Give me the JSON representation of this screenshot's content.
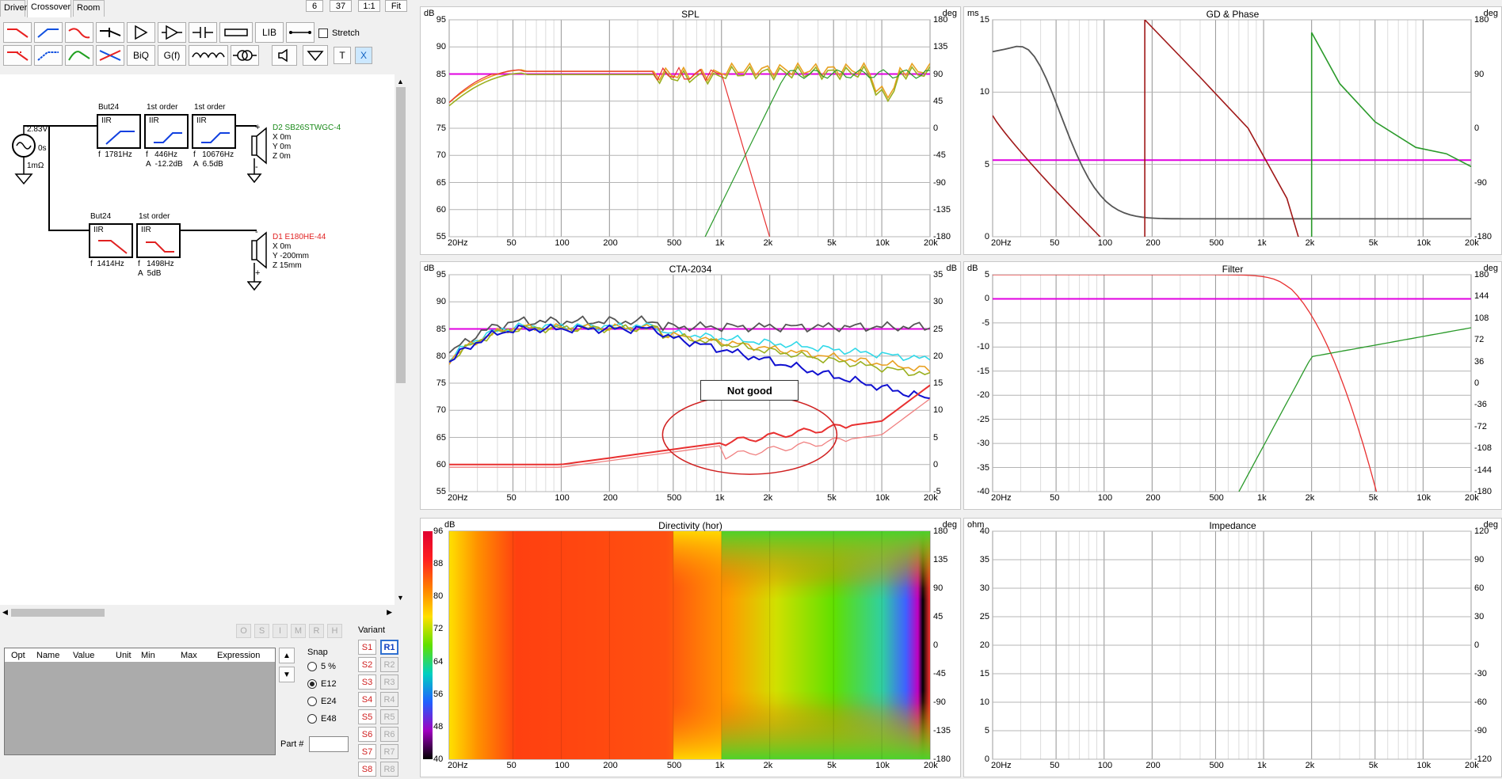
{
  "tabs": [
    "Drivers",
    "Crossover",
    "Room"
  ],
  "top_buttons": [
    "6",
    "37",
    "1:1",
    "Fit"
  ],
  "toolbar": {
    "lib": "LIB",
    "biq": "BiQ",
    "gf": "G(f)",
    "t": "T",
    "x": "X",
    "stretch": "Stretch"
  },
  "schematic": {
    "source": {
      "voltage": "2.83V",
      "delay": "0s",
      "resistance": "1mΩ"
    },
    "tweeter_chain": [
      {
        "title": "But24",
        "type": "IIR",
        "params": "f  1781Hz"
      },
      {
        "title": "1st order",
        "type": "IIR",
        "params": "f   446Hz\nA  -12.2dB"
      },
      {
        "title": "1st order",
        "type": "IIR",
        "params": "f   10676Hz\nA  6.5dB"
      }
    ],
    "woofer_chain": [
      {
        "title": "But24",
        "type": "IIR",
        "params": "f  1414Hz"
      },
      {
        "title": "1st order",
        "type": "IIR",
        "params": "f   1498Hz\nA  5dB"
      }
    ],
    "tweeter": {
      "name": "D2 SB26STWGC-4",
      "lines": [
        "X 0m",
        "Y 0m",
        "Z 0m"
      ]
    },
    "woofer": {
      "name": "D1 E180HE-44",
      "lines": [
        "X 0m",
        "Y -200mm",
        "Z 15mm"
      ]
    }
  },
  "optimizer": {
    "buttons": [
      "O",
      "S",
      "I",
      "M",
      "R",
      "H"
    ],
    "columns": [
      "Opt",
      "Name",
      "Value",
      "Unit",
      "Min",
      "Max",
      "Expression"
    ]
  },
  "snap": {
    "label": "Snap",
    "options": [
      "5 %",
      "E12",
      "E24",
      "E48"
    ],
    "selected": 1
  },
  "part_label": "Part #",
  "variant": {
    "label": "Variant",
    "s": [
      "S1",
      "S2",
      "S3",
      "S4",
      "S5",
      "S6",
      "S7",
      "S8"
    ],
    "r": [
      "R1",
      "R2",
      "R3",
      "R4",
      "R5",
      "R6",
      "R7",
      "R8"
    ]
  },
  "colors": {
    "magenta": "#e000e0",
    "red": "#e83030",
    "green": "#2a9a2a",
    "darkred": "#a01818",
    "blue": "#1010d0",
    "gray": "#555555",
    "olive": "#9ab020",
    "orange": "#e8a020",
    "cyan": "#30d8e8"
  },
  "freq_ticks": [
    "20Hz",
    "50",
    "100",
    "200",
    "500",
    "1k",
    "2k",
    "5k",
    "10k",
    "20k"
  ],
  "panels": {
    "spl": {
      "title": "SPL",
      "ylabel": "dB",
      "y2label": "deg",
      "yticks": [
        "95",
        "90",
        "85",
        "80",
        "75",
        "70",
        "65",
        "60",
        "55"
      ],
      "y2ticks": [
        "180",
        "135",
        "90",
        "45",
        "0",
        "-45",
        "-90",
        "-135",
        "-180"
      ]
    },
    "gd": {
      "title": "GD & Phase",
      "ylabel": "ms",
      "y2label": "deg",
      "yticks": [
        "15",
        "10",
        "5",
        "0"
      ],
      "y2ticks": [
        "180",
        "90",
        "0",
        "-90",
        "-180"
      ]
    },
    "cta": {
      "title": "CTA-2034",
      "ylabel": "dB",
      "y2label": "dB",
      "yticks": [
        "95",
        "90",
        "85",
        "80",
        "75",
        "70",
        "65",
        "60",
        "55"
      ],
      "y2ticks": [
        "35",
        "30",
        "25",
        "20",
        "15",
        "10",
        "5",
        "0",
        "-5"
      ],
      "annotation": "Not good"
    },
    "filter": {
      "title": "Filter",
      "ylabel": "dB",
      "y2label": "deg",
      "yticks": [
        "5",
        "0",
        "-5",
        "-10",
        "-15",
        "-20",
        "-25",
        "-30",
        "-35",
        "-40"
      ],
      "y2ticks": [
        "180",
        "144",
        "108",
        "72",
        "36",
        "0",
        "-36",
        "-72",
        "-108",
        "-144",
        "-180"
      ]
    },
    "dir": {
      "title": "Directivity (hor)",
      "ylabel": "dB",
      "y2label": "deg",
      "scale": [
        "96",
        "88",
        "80",
        "72",
        "64",
        "56",
        "48",
        "40"
      ],
      "y2ticks": [
        "180",
        "135",
        "90",
        "45",
        "0",
        "-45",
        "-90",
        "-135",
        "-180"
      ]
    },
    "imp": {
      "title": "Impedance",
      "ylabel": "ohm",
      "y2label": "deg",
      "yticks": [
        "40",
        "35",
        "30",
        "25",
        "20",
        "15",
        "10",
        "5",
        "0"
      ],
      "y2ticks": [
        "120",
        "90",
        "60",
        "30",
        "0",
        "-30",
        "-60",
        "-90",
        "-120"
      ]
    }
  }
}
